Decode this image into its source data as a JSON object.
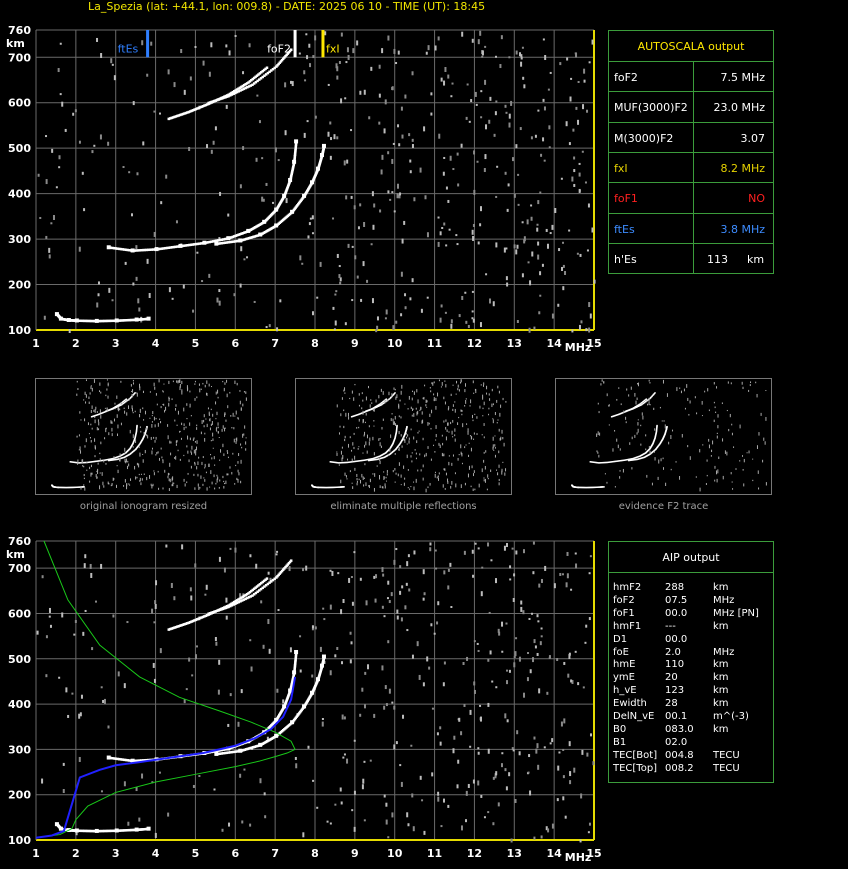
{
  "header": {
    "title": "La_Spezia (lat: +44.1, lon: 009.8) - DATE: 2025 06 10 - TIME (UT): 18:45"
  },
  "autoscala": {
    "title": "AUTOSCALA output",
    "rows": [
      {
        "label": "foF2",
        "value": "7.5 MHz",
        "color": "#ffffff"
      },
      {
        "label": "MUF(3000)F2",
        "value": "23.0 MHz",
        "color": "#ffffff"
      },
      {
        "label": "M(3000)F2",
        "value": "3.07",
        "color": "#ffffff"
      },
      {
        "label": "fxI",
        "value": "8.2 MHz",
        "color": "#e6d200"
      },
      {
        "label": "foF1",
        "value": "NO",
        "color": "#ff2020"
      },
      {
        "label": "ftEs",
        "value": "3.8 MHz",
        "color": "#3d8cff"
      },
      {
        "label": "h'Es",
        "value": "113",
        "unit": "km",
        "color": "#ffffff"
      }
    ]
  },
  "aip": {
    "title": "AIP output",
    "rows": [
      {
        "label": "hmF2",
        "value": "288",
        "unit": "km"
      },
      {
        "label": "foF2",
        "value": "07.5",
        "unit": "MHz"
      },
      {
        "label": "foF1",
        "value": "00.0",
        "unit": "MHz  [PN]"
      },
      {
        "label": "hmF1",
        "value": "---",
        "unit": "km"
      },
      {
        "label": "D1",
        "value": "00.0",
        "unit": ""
      },
      {
        "label": "foE",
        "value": "2.0",
        "unit": "MHz"
      },
      {
        "label": "hmE",
        "value": "110",
        "unit": "km"
      },
      {
        "label": "ymE",
        "value": "20",
        "unit": "km"
      },
      {
        "label": "h_vE",
        "value": "123",
        "unit": "km"
      },
      {
        "label": "Ewidth",
        "value": "28",
        "unit": "km"
      },
      {
        "label": "DelN_vE",
        "value": "00.1",
        "unit": "m^(-3)"
      },
      {
        "label": "B0",
        "value": "083.0",
        "unit": "km"
      },
      {
        "label": "B1",
        "value": "02.0",
        "unit": ""
      },
      {
        "label": "TEC[Bot]",
        "value": "004.8",
        "unit": "TECU"
      },
      {
        "label": "TEC[Top]",
        "value": "008.2",
        "unit": "TECU"
      }
    ]
  },
  "captions": {
    "original": "original ionogram resized",
    "multiple": "eliminate multiple reflections",
    "evidence": "evidence F2 trace"
  },
  "chart_data": [
    {
      "type": "scatter",
      "title": "",
      "xlabel": "MHz",
      "ylabel": "km",
      "xlim": [
        1,
        15
      ],
      "ylim": [
        100,
        760
      ],
      "xticks": [
        "1",
        "2",
        "3",
        "4",
        "5",
        "6",
        "7",
        "8",
        "9",
        "10",
        "11",
        "12",
        "13",
        "14",
        "15"
      ],
      "yticks": [
        "100",
        "200",
        "300",
        "400",
        "500",
        "600",
        "700",
        "760"
      ],
      "markers": [
        {
          "name": "ftEs",
          "x": 3.8,
          "color": "#2f7fff"
        },
        {
          "name": "foF2",
          "x": 7.5,
          "color": "#ffffff"
        },
        {
          "name": "fxI",
          "x": 8.2,
          "color": "#ffe800"
        }
      ],
      "traces": {
        "es": {
          "x": [
            1.5,
            1.6,
            1.8,
            2.0,
            2.5,
            3.0,
            3.5,
            3.8
          ],
          "y": [
            135,
            125,
            122,
            121,
            120,
            121,
            123,
            125
          ]
        },
        "o_trace": {
          "x": [
            2.8,
            3.4,
            4.0,
            4.6,
            5.2,
            5.8,
            6.3,
            6.7,
            7.0,
            7.2,
            7.35,
            7.45,
            7.5
          ],
          "y": [
            282,
            275,
            278,
            285,
            292,
            302,
            318,
            338,
            365,
            395,
            430,
            470,
            515
          ]
        },
        "x_trace": {
          "x": [
            5.5,
            6.1,
            6.6,
            7.0,
            7.4,
            7.7,
            7.9,
            8.05,
            8.15,
            8.2
          ],
          "y": [
            290,
            297,
            310,
            330,
            360,
            395,
            425,
            455,
            485,
            505
          ]
        },
        "o_second": {
          "x": [
            4.3,
            4.8,
            5.3,
            5.8,
            6.3,
            6.8
          ],
          "y": [
            565,
            580,
            598,
            618,
            645,
            680
          ]
        },
        "x_second": {
          "x": [
            5.3,
            5.8,
            6.4,
            7.0,
            7.4
          ],
          "y": [
            600,
            615,
            640,
            680,
            720
          ]
        }
      }
    },
    {
      "type": "line",
      "title": "",
      "xlabel": "MHz",
      "ylabel": "km",
      "xlim": [
        1,
        15
      ],
      "ylim": [
        100,
        760
      ],
      "xticks": [
        "1",
        "2",
        "3",
        "4",
        "5",
        "6",
        "7",
        "8",
        "9",
        "10",
        "11",
        "12",
        "13",
        "14",
        "15"
      ],
      "yticks": [
        "100",
        "200",
        "300",
        "400",
        "500",
        "600",
        "700",
        "760"
      ],
      "series": [
        {
          "color": "#19c819",
          "x": [
            1.0,
            1.6,
            1.9,
            2.0,
            2.3,
            3.0,
            4.0,
            5.0,
            6.0,
            6.6,
            7.0,
            7.3,
            7.5,
            7.4,
            7.0,
            6.4,
            5.6,
            4.6,
            3.6,
            2.6,
            1.8,
            1.2
          ],
          "y": [
            105,
            112,
            125,
            145,
            175,
            205,
            228,
            245,
            262,
            274,
            284,
            292,
            300,
            318,
            338,
            360,
            385,
            415,
            460,
            530,
            630,
            760
          ]
        },
        {
          "color": "#2020ff",
          "x": [
            1.0,
            1.4,
            1.7,
            2.1,
            2.6,
            3.0,
            3.6,
            4.4,
            5.2,
            6.0,
            6.5,
            6.9,
            7.2,
            7.4,
            7.5
          ],
          "y": [
            105,
            110,
            120,
            238,
            255,
            265,
            272,
            282,
            292,
            308,
            325,
            345,
            372,
            410,
            460
          ]
        }
      ]
    }
  ]
}
